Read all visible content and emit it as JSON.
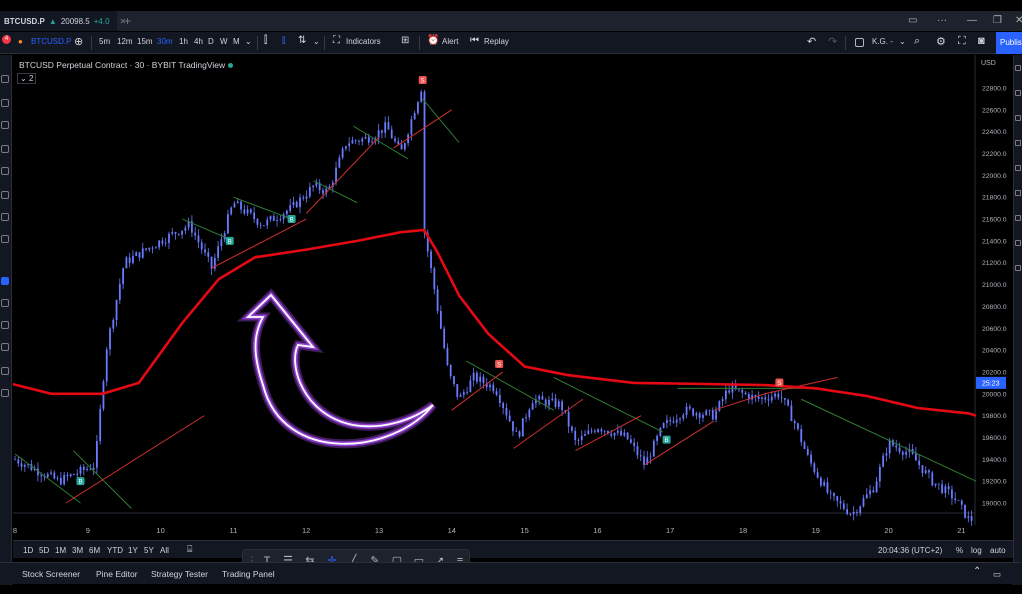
{
  "tab": {
    "symbol": "BTCUSD.P",
    "price": "20098.5",
    "change": "+4.0",
    "badge": "4"
  },
  "toolbar": {
    "symbol": "BTCUSD.P",
    "intervals": [
      "5m",
      "15m",
      "1h",
      "4h",
      "D",
      "W",
      "M"
    ],
    "intervals_shown": [
      "5m",
      "12m",
      "15m",
      "30m",
      "1h",
      "4h",
      "D",
      "W",
      "M"
    ],
    "indicators_label": "Indicators",
    "alert_label": "Alert",
    "replay_label": "Replay",
    "layout_name": "K.G. -",
    "publish_label": "Publish"
  },
  "legend": {
    "title": "BTCUSD Perpetual Contract · 30 · BYBIT  TradingView",
    "level": "2"
  },
  "price_axis": {
    "currency": "USD",
    "labels": [
      "22800.0",
      "22600.0",
      "22400.0",
      "22200.0",
      "22000.0",
      "21800.0",
      "21600.0",
      "21400.0",
      "21200.0",
      "21000.0",
      "20800.0",
      "20600.0",
      "20400.0",
      "20200.0",
      "20000.0",
      "19800.0",
      "19600.0",
      "19400.0",
      "19200.0",
      "19000.0"
    ],
    "current_tag": "25:23",
    "current_price_color": "#2962ff"
  },
  "time_axis": {
    "labels": [
      "8",
      "9",
      "10",
      "11",
      "12",
      "13",
      "14",
      "15",
      "16",
      "17",
      "18",
      "19",
      "20",
      "21"
    ]
  },
  "bottom": {
    "ranges": [
      "1D",
      "5D",
      "1M",
      "3M",
      "6M",
      "YTD",
      "1Y",
      "5Y",
      "All"
    ],
    "clock": "20:04:36 (UTC+2)",
    "percent": "%",
    "log": "log",
    "auto": "auto"
  },
  "panels": [
    "Stock Screener",
    "Pine Editor",
    "Strategy Tester",
    "Trading Panel"
  ],
  "colors": {
    "ma_line": "#e50914",
    "candles": "#6a7bff",
    "green_trend": "#2e7d32",
    "red_trend": "#d32f2f",
    "arrow_glow": "#b24dff",
    "sell_marker": "#ef5350",
    "buy_marker": "#26a69a"
  },
  "markers": {
    "sell": "S",
    "buy": "B"
  }
}
